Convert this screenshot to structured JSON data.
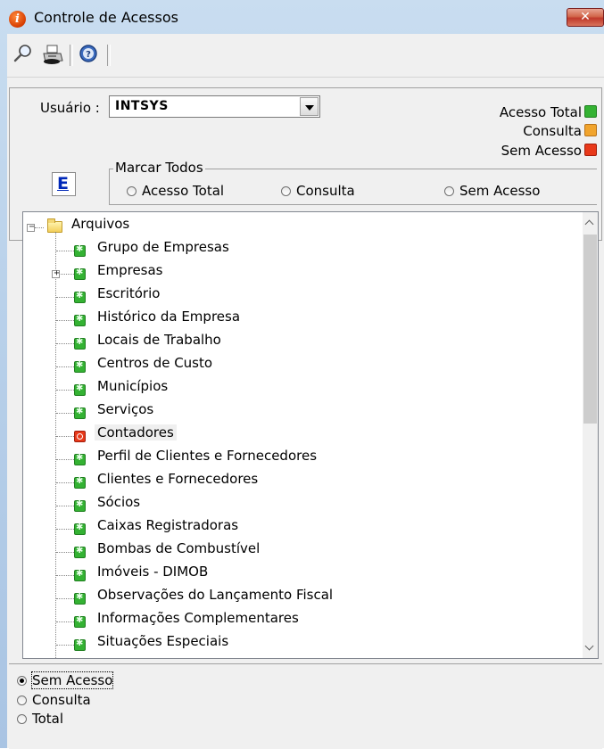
{
  "window": {
    "title": "Controle de Acessos",
    "close_label": "✕"
  },
  "toolbar": {
    "icons": [
      "search-icon",
      "printer-icon",
      "info-icon"
    ]
  },
  "usuario": {
    "label": "Usuário :",
    "value": "INTSYS"
  },
  "legend": {
    "total": "Acesso Total",
    "consulta": "Consulta",
    "sem": "Sem Acesso"
  },
  "e_button": {
    "label": "E"
  },
  "marcar": {
    "title": "Marcar Todos",
    "options": [
      "Acesso Total",
      "Consulta",
      "Sem Acesso"
    ]
  },
  "tree": {
    "root": "Arquivos",
    "items": [
      {
        "label": "Grupo de Empresas",
        "status": "total",
        "expander": false
      },
      {
        "label": "Empresas",
        "status": "total",
        "expander": true
      },
      {
        "label": "Escritório",
        "status": "total",
        "expander": false
      },
      {
        "label": "Histórico da Empresa",
        "status": "total",
        "expander": false
      },
      {
        "label": "Locais de Trabalho",
        "status": "total",
        "expander": false
      },
      {
        "label": "Centros de Custo",
        "status": "total",
        "expander": false
      },
      {
        "label": "Municípios",
        "status": "total",
        "expander": false
      },
      {
        "label": "Serviços",
        "status": "total",
        "expander": false
      },
      {
        "label": "Contadores",
        "status": "sem",
        "expander": false
      },
      {
        "label": "Perfil de Clientes e Fornecedores",
        "status": "total",
        "expander": false
      },
      {
        "label": "Clientes e Fornecedores",
        "status": "total",
        "expander": false
      },
      {
        "label": "Sócios",
        "status": "total",
        "expander": false
      },
      {
        "label": "Caixas Registradoras",
        "status": "total",
        "expander": false
      },
      {
        "label": "Bombas de Combustível",
        "status": "total",
        "expander": false
      },
      {
        "label": "Imóveis - DIMOB",
        "status": "total",
        "expander": false
      },
      {
        "label": "Observações do Lançamento Fiscal",
        "status": "total",
        "expander": false
      },
      {
        "label": "Informações Complementares",
        "status": "total",
        "expander": false
      },
      {
        "label": "Situações Especiais",
        "status": "total",
        "expander": false
      }
    ]
  },
  "access_options": {
    "items": [
      "Sem Acesso",
      "Consulta",
      "Total"
    ],
    "selected": "Sem Acesso"
  },
  "colors": {
    "total": "#34b233",
    "consulta": "#f1a42d",
    "sem": "#e8391a"
  }
}
